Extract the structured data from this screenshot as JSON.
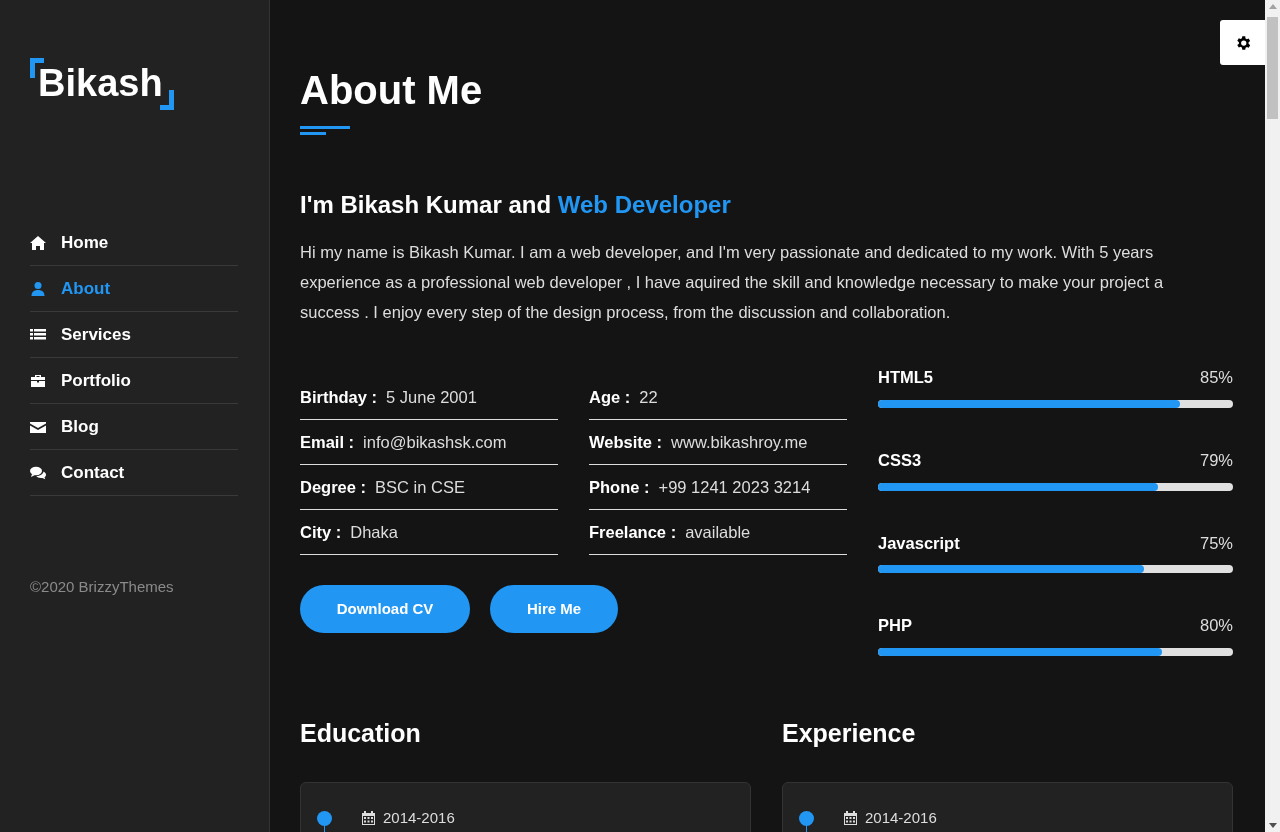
{
  "sidebar": {
    "logo": "Bikash",
    "nav": [
      {
        "label": "Home",
        "selected": false
      },
      {
        "label": "About",
        "selected": true
      },
      {
        "label": "Services",
        "selected": false
      },
      {
        "label": "Portfolio",
        "selected": false
      },
      {
        "label": "Blog",
        "selected": false
      },
      {
        "label": "Contact",
        "selected": false
      }
    ],
    "copyright": "©2020 BrizzyThemes"
  },
  "about": {
    "title": "About Me",
    "headline": {
      "text": "I'm Bikash Kumar and",
      "highlight": "Web Developer"
    },
    "bio": "Hi my name is Bikash Kumar. I am a web developer, and I'm very passionate and dedicated to my work. With 5 years experience as a professional web developer , I have aquired the skill and knowledge necessary to make your project a success . I enjoy every step of the design process, from the discussion and collaboration.",
    "info_columns": [
      [
        {
          "label": "Birthday :",
          "value": "5 June 2001"
        },
        {
          "label": "Email :",
          "value": "info@bikashsk.com"
        },
        {
          "label": "Degree :",
          "value": "BSC in CSE"
        },
        {
          "label": "City :",
          "value": "Dhaka"
        }
      ],
      [
        {
          "label": "Age :",
          "value": "22"
        },
        {
          "label": "Website :",
          "value": "www.bikashroy.me"
        },
        {
          "label": "Phone :",
          "value": "+99 1241 2023 3214"
        },
        {
          "label": "Freelance :",
          "value": "available"
        }
      ]
    ],
    "buttons": [
      "Download CV",
      "Hire Me"
    ],
    "skills": [
      {
        "name": "HTML5",
        "reading": "85%",
        "level": 0.85
      },
      {
        "name": "CSS3",
        "reading": "79%",
        "level": 0.79
      },
      {
        "name": "Javascript",
        "reading": "75%",
        "level": 0.75
      },
      {
        "name": "PHP",
        "reading": "80%",
        "level": 0.8
      }
    ]
  },
  "timelines": [
    {
      "title": "Education",
      "entries": [
        {
          "date": "2014-2016"
        }
      ]
    },
    {
      "title": "Experience",
      "entries": [
        {
          "date": "2014-2016"
        }
      ]
    }
  ]
}
